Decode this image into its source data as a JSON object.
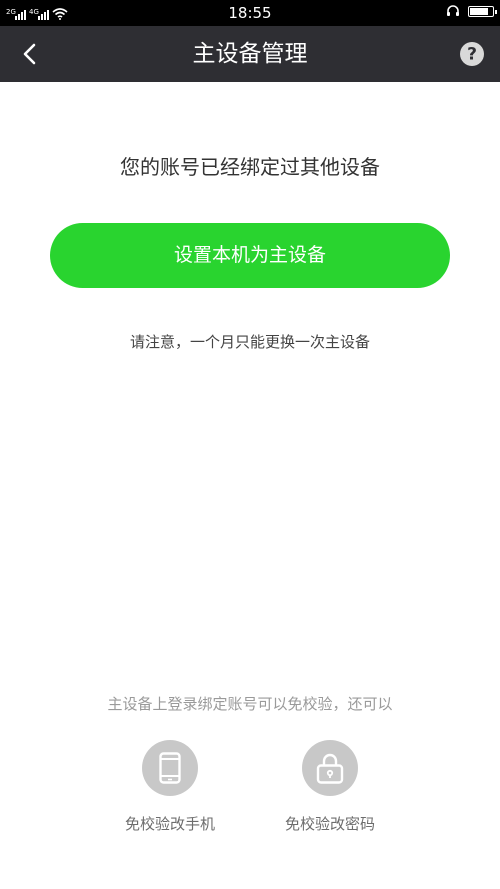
{
  "status_bar": {
    "time": "18:55",
    "network_1": "2G",
    "network_2": "4G",
    "icons": [
      "signal-icon",
      "signal-icon",
      "wifi-icon",
      "headset-icon",
      "battery-icon"
    ],
    "battery_level": 0.85
  },
  "header": {
    "title": "主设备管理",
    "back_icon": "back-arrow-icon",
    "help_icon": "help-icon"
  },
  "main": {
    "prompt": "您的账号已经绑定过其他设备",
    "set_primary_button": "设置本机为主设备",
    "note": "请注意，一个月只能更换一次主设备"
  },
  "footer": {
    "tip": "主设备上登录绑定账号可以免校验，还可以",
    "features": [
      {
        "label": "免校验改手机",
        "icon": "phone-icon"
      },
      {
        "label": "免校验改密码",
        "icon": "lock-icon"
      }
    ]
  },
  "colors": {
    "primary_green": "#29d42f",
    "header_bg": "#2e2e33",
    "status_bg": "#000000"
  }
}
